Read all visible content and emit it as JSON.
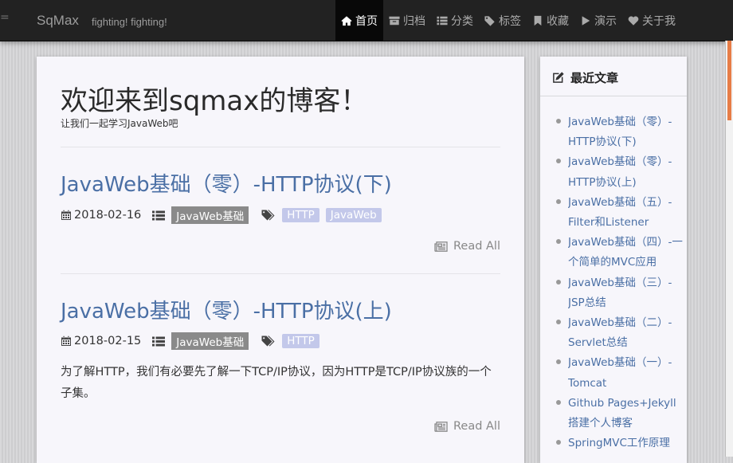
{
  "navbar": {
    "brand": "SqMax",
    "tagline": "fighting! fighting!",
    "menu": [
      {
        "label": "首页",
        "icon": "home-icon",
        "active": true
      },
      {
        "label": "归档",
        "icon": "archive-icon",
        "active": false
      },
      {
        "label": "分类",
        "icon": "list-icon",
        "active": false
      },
      {
        "label": "标签",
        "icon": "tags-icon",
        "active": false
      },
      {
        "label": "收藏",
        "icon": "bookmark-icon",
        "active": false
      },
      {
        "label": "演示",
        "icon": "play-icon",
        "active": false
      },
      {
        "label": "关于我",
        "icon": "heart-icon",
        "active": false
      }
    ]
  },
  "main": {
    "title": "欢迎来到sqmax的博客！",
    "subtitle": "让我们一起学习JavaWeb吧",
    "posts": [
      {
        "title": "JavaWeb基础（零）-HTTP协议(下)",
        "date": "2018-02-16",
        "category": "JavaWeb基础",
        "tags": [
          "HTTP",
          "JavaWeb"
        ],
        "excerpt": "",
        "read_all": "Read All"
      },
      {
        "title": "JavaWeb基础（零）-HTTP协议(上)",
        "date": "2018-02-15",
        "category": "JavaWeb基础",
        "tags": [
          "HTTP"
        ],
        "excerpt": "为了解HTTP，我们有必要先了解一下TCP/IP协议，因为HTTP是TCP/IP协议族的一个子集。",
        "read_all": "Read All"
      }
    ]
  },
  "sidebar": {
    "title": "最近文章",
    "recent": [
      "JavaWeb基础（零）-HTTP协议(下)",
      "JavaWeb基础（零）-HTTP协议(上)",
      "JavaWeb基础（五）-Filter和Listener",
      "JavaWeb基础（四）-一个简单的MVC应用",
      "JavaWeb基础（三）-JSP总结",
      "JavaWeb基础（二）-Servlet总结",
      "JavaWeb基础（一）-Tomcat",
      "Github Pages+Jekyll搭建个人博客",
      "SpringMVC工作原理"
    ]
  },
  "colors": {
    "navbar_bg": "#222222",
    "active_bg": "#080808",
    "link": "#4a6fa5",
    "category_badge": "#8a8a8a",
    "tag_badge": "#c3c8ea",
    "accent": "#e77d47"
  }
}
